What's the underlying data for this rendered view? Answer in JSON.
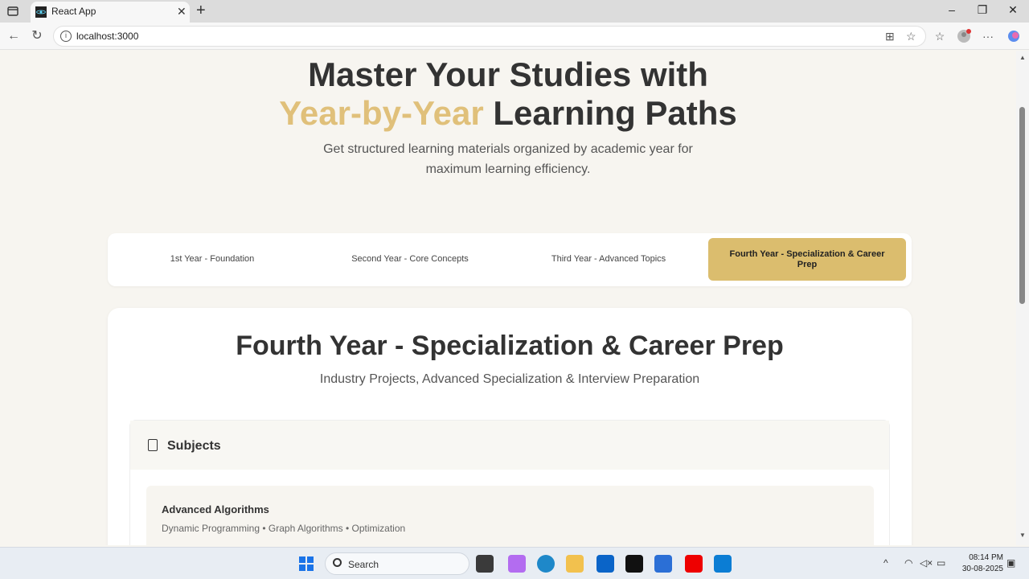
{
  "browser": {
    "tab_title": "React App",
    "url": "localhost:3000"
  },
  "hero": {
    "title_line1": "Master Your Studies with",
    "title_accent": "Year-by-Year",
    "title_rest": " Learning Paths",
    "subtitle": "Get structured learning materials organized by academic year for maximum learning efficiency."
  },
  "year_tabs": [
    {
      "label": "1st Year - Foundation",
      "active": false
    },
    {
      "label": "Second Year - Core Concepts",
      "active": false
    },
    {
      "label": "Third Year - Advanced Topics",
      "active": false
    },
    {
      "label": "Fourth Year - Specialization & Career Prep",
      "active": true
    }
  ],
  "year_card": {
    "title": "Fourth Year - Specialization & Career Prep",
    "subtitle": "Industry Projects, Advanced Specialization & Interview Preparation",
    "subjects_heading": "Subjects",
    "subjects": [
      {
        "name": "Advanced Algorithms",
        "topics": "Dynamic Programming • Graph Algorithms • Optimization"
      }
    ]
  },
  "taskbar": {
    "search_label": "Search",
    "time": "08:14 PM",
    "date": "30-08-2025"
  },
  "colors": {
    "accent": "#e0c07a",
    "active_tab": "#dbbd6e",
    "page_bg": "#f7f5f0"
  }
}
